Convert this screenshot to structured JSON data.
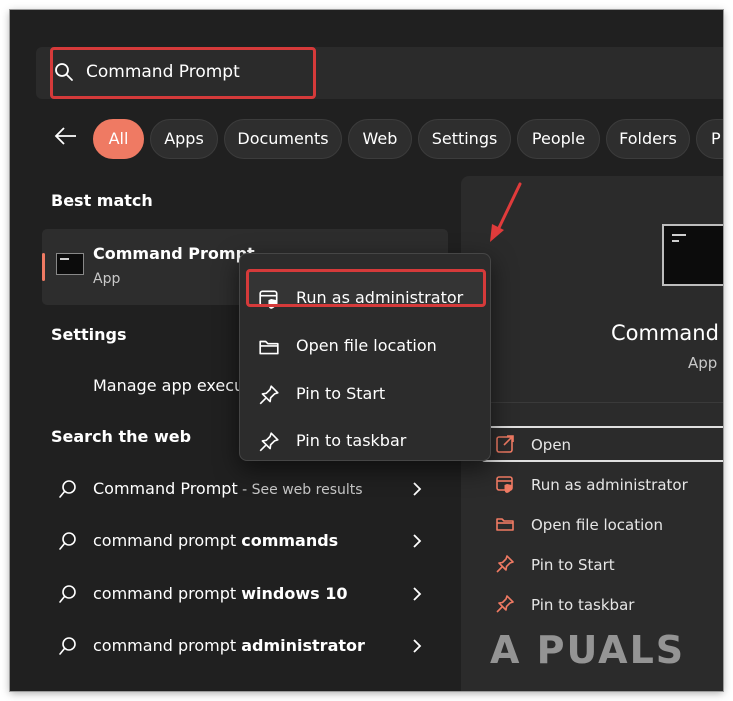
{
  "search": {
    "query": "Command Prompt"
  },
  "filters": [
    "All",
    "Apps",
    "Documents",
    "Web",
    "Settings",
    "People",
    "Folders",
    "P"
  ],
  "best_match": {
    "heading": "Best match",
    "title": "Command Prompt",
    "subtitle": "App"
  },
  "settings": {
    "heading": "Settings",
    "item": "Manage app execu"
  },
  "web": {
    "heading": "Search the web",
    "results": [
      {
        "plain": "Command Prompt",
        "bold": "",
        "suffix": " - See web results"
      },
      {
        "plain": "command prompt ",
        "bold": "commands",
        "suffix": ""
      },
      {
        "plain": "command prompt ",
        "bold": "windows 10",
        "suffix": ""
      },
      {
        "plain": "command prompt ",
        "bold": "administrator",
        "suffix": ""
      }
    ]
  },
  "context_menu": {
    "items": [
      {
        "label": "Run as administrator",
        "icon": "shield-window-icon"
      },
      {
        "label": "Open file location",
        "icon": "folder-icon"
      },
      {
        "label": "Pin to Start",
        "icon": "pin-icon"
      },
      {
        "label": "Pin to taskbar",
        "icon": "pin-icon"
      }
    ]
  },
  "preview": {
    "title": "Command P",
    "subtitle": "App",
    "actions": [
      {
        "label": "Open",
        "icon": "open-external-icon"
      },
      {
        "label": "Run as administrator",
        "icon": "shield-window-icon"
      },
      {
        "label": "Open file location",
        "icon": "folder-icon"
      },
      {
        "label": "Pin to Start",
        "icon": "pin-icon"
      },
      {
        "label": "Pin to taskbar",
        "icon": "pin-icon"
      }
    ]
  },
  "watermark": {
    "text": "A PUALS"
  },
  "colors": {
    "background": "#202020",
    "panel": "#2b2b2b",
    "accent": "#ef7a63",
    "annotation": "#d53a3a"
  }
}
